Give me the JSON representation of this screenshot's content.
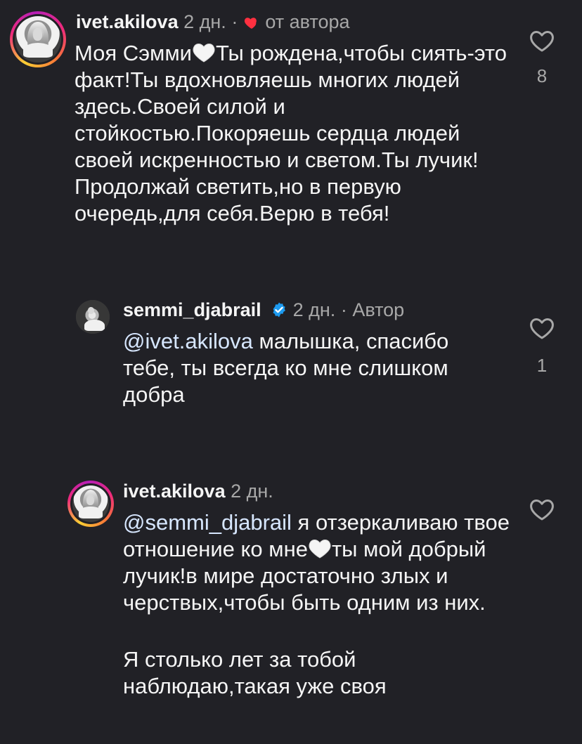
{
  "comments": [
    {
      "username": "ivet.akilova",
      "time": "2 дн.",
      "separator": "·",
      "liked_by_author_label": "от автора",
      "text_before_heart": "Моя Сэмми",
      "text_after_heart": "Ты рождена,чтобы сиять-это факт!Ты вдохновляешь многих людей здесь.Своей силой и стойкостью.Покоряешь сердца людей своей искренностью и светом.Ты лучик!Продолжай светить,но в первую очередь,для себя.Верю в тебя!",
      "likes": "8"
    },
    {
      "username": "semmi_djabrail",
      "time": "2 дн.",
      "separator": "·",
      "author_label": "Автор",
      "mention": "@ivet.akilova",
      "text": " малышка, спасибо тебе, ты всегда ко мне слишком добра",
      "likes": "1"
    },
    {
      "username": "ivet.akilova",
      "time": "2 дн.",
      "mention": "@semmi_djabrail",
      "text_before_heart": " я отзеркаливаю твое отношение ко мне",
      "text_after_heart": "ты мой добрый лучик!в мире достаточно злых и черствых,чтобы быть одним из них.",
      "second_paragraph": "Я столько лет за тобой наблюдаю,такая уже своя"
    }
  ],
  "colors": {
    "background": "#212126",
    "text": "#f5f5f5",
    "muted": "#a8a8a8",
    "mention": "#d7e7ff",
    "like_red": "#ff3040",
    "verified_blue": "#1d9bf0"
  },
  "icons": {
    "like": "heart-outline-icon",
    "author_like": "heart-filled-icon",
    "verified": "verified-badge-icon",
    "emoji": "white-heart-emoji-icon"
  }
}
